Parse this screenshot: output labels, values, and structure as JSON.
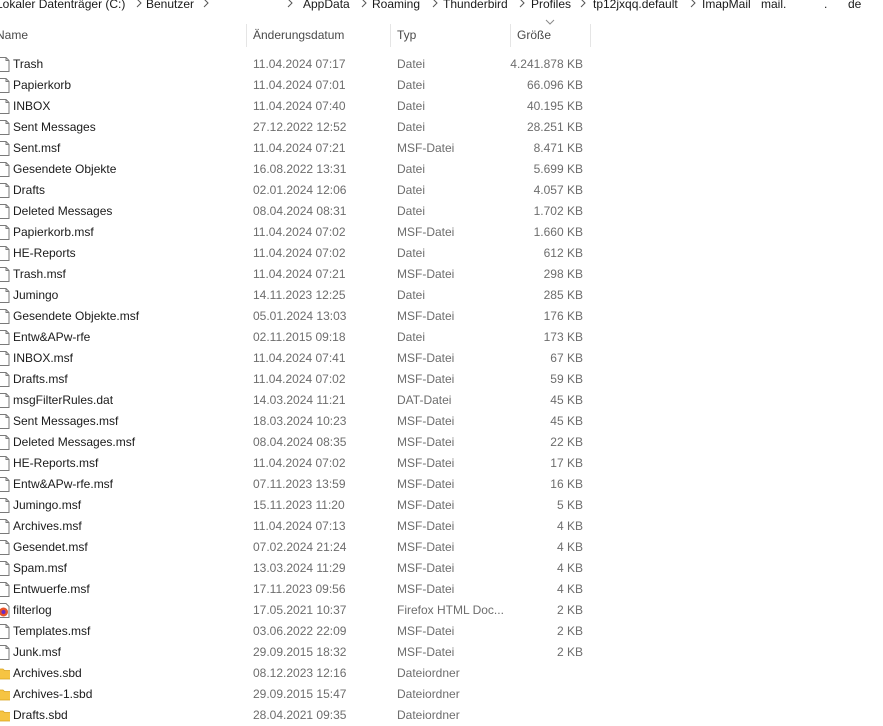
{
  "breadcrumb": {
    "segments": [
      "Lokaler Datenträger (C:)",
      "Benutzer",
      "AppData",
      "Roaming",
      "Thunderbird",
      "Profiles",
      "tp12jxqq.default",
      "ImapMail",
      "mail.",
      ".",
      "de"
    ]
  },
  "columns": {
    "name": "Name",
    "date": "Änderungsdatum",
    "type": "Typ",
    "size": "Größe"
  },
  "icons": {
    "file": "file-icon",
    "folder": "folder-icon",
    "html": "firefox-html-icon",
    "separator": "chevron-right-icon",
    "sort": "sort-descending-icon"
  },
  "colors": {
    "folder": "#f6c443",
    "firefox": "#e8532a"
  },
  "files": [
    {
      "name": "Trash",
      "date": "11.04.2024 07:17",
      "type": "Datei",
      "size": "4.241.878 KB",
      "icon": "file"
    },
    {
      "name": "Papierkorb",
      "date": "11.04.2024 07:01",
      "type": "Datei",
      "size": "66.096 KB",
      "icon": "file"
    },
    {
      "name": "INBOX",
      "date": "11.04.2024 07:40",
      "type": "Datei",
      "size": "40.195 KB",
      "icon": "file"
    },
    {
      "name": "Sent Messages",
      "date": "27.12.2022 12:52",
      "type": "Datei",
      "size": "28.251 KB",
      "icon": "file"
    },
    {
      "name": "Sent.msf",
      "date": "11.04.2024 07:21",
      "type": "MSF-Datei",
      "size": "8.471 KB",
      "icon": "file"
    },
    {
      "name": "Gesendete Objekte",
      "date": "16.08.2022 13:31",
      "type": "Datei",
      "size": "5.699 KB",
      "icon": "file"
    },
    {
      "name": "Drafts",
      "date": "02.01.2024 12:06",
      "type": "Datei",
      "size": "4.057 KB",
      "icon": "file"
    },
    {
      "name": "Deleted Messages",
      "date": "08.04.2024 08:31",
      "type": "Datei",
      "size": "1.702 KB",
      "icon": "file"
    },
    {
      "name": "Papierkorb.msf",
      "date": "11.04.2024 07:02",
      "type": "MSF-Datei",
      "size": "1.660 KB",
      "icon": "file"
    },
    {
      "name": "HE-Reports",
      "date": "11.04.2024 07:02",
      "type": "Datei",
      "size": "612 KB",
      "icon": "file"
    },
    {
      "name": "Trash.msf",
      "date": "11.04.2024 07:21",
      "type": "MSF-Datei",
      "size": "298 KB",
      "icon": "file"
    },
    {
      "name": "Jumingo",
      "date": "14.11.2023 12:25",
      "type": "Datei",
      "size": "285 KB",
      "icon": "file"
    },
    {
      "name": "Gesendete Objekte.msf",
      "date": "05.01.2024 13:03",
      "type": "MSF-Datei",
      "size": "176 KB",
      "icon": "file"
    },
    {
      "name": "Entw&APw-rfe",
      "date": "02.11.2015 09:18",
      "type": "Datei",
      "size": "173 KB",
      "icon": "file"
    },
    {
      "name": "INBOX.msf",
      "date": "11.04.2024 07:41",
      "type": "MSF-Datei",
      "size": "67 KB",
      "icon": "file"
    },
    {
      "name": "Drafts.msf",
      "date": "11.04.2024 07:02",
      "type": "MSF-Datei",
      "size": "59 KB",
      "icon": "file"
    },
    {
      "name": "msgFilterRules.dat",
      "date": "14.03.2024 11:21",
      "type": "DAT-Datei",
      "size": "45 KB",
      "icon": "file"
    },
    {
      "name": "Sent Messages.msf",
      "date": "18.03.2024 10:23",
      "type": "MSF-Datei",
      "size": "45 KB",
      "icon": "file"
    },
    {
      "name": "Deleted Messages.msf",
      "date": "08.04.2024 08:35",
      "type": "MSF-Datei",
      "size": "22 KB",
      "icon": "file"
    },
    {
      "name": "HE-Reports.msf",
      "date": "11.04.2024 07:02",
      "type": "MSF-Datei",
      "size": "17 KB",
      "icon": "file"
    },
    {
      "name": "Entw&APw-rfe.msf",
      "date": "07.11.2023 13:59",
      "type": "MSF-Datei",
      "size": "16 KB",
      "icon": "file"
    },
    {
      "name": "Jumingo.msf",
      "date": "15.11.2023 11:20",
      "type": "MSF-Datei",
      "size": "5 KB",
      "icon": "file"
    },
    {
      "name": "Archives.msf",
      "date": "11.04.2024 07:13",
      "type": "MSF-Datei",
      "size": "4 KB",
      "icon": "file"
    },
    {
      "name": "Gesendet.msf",
      "date": "07.02.2024 21:24",
      "type": "MSF-Datei",
      "size": "4 KB",
      "icon": "file"
    },
    {
      "name": "Spam.msf",
      "date": "13.03.2024 11:29",
      "type": "MSF-Datei",
      "size": "4 KB",
      "icon": "file"
    },
    {
      "name": "Entwuerfe.msf",
      "date": "17.11.2023 09:56",
      "type": "MSF-Datei",
      "size": "4 KB",
      "icon": "file"
    },
    {
      "name": "filterlog",
      "date": "17.05.2021 10:37",
      "type": "Firefox HTML Doc...",
      "size": "2 KB",
      "icon": "html"
    },
    {
      "name": "Templates.msf",
      "date": "03.06.2022 22:09",
      "type": "MSF-Datei",
      "size": "2 KB",
      "icon": "file"
    },
    {
      "name": "Junk.msf",
      "date": "29.09.2015 18:32",
      "type": "MSF-Datei",
      "size": "2 KB",
      "icon": "file"
    },
    {
      "name": "Archives.sbd",
      "date": "08.12.2023 12:16",
      "type": "Dateiordner",
      "size": "",
      "icon": "folder"
    },
    {
      "name": "Archives-1.sbd",
      "date": "29.09.2015 15:47",
      "type": "Dateiordner",
      "size": "",
      "icon": "folder"
    },
    {
      "name": "Drafts.sbd",
      "date": "28.04.2021 09:35",
      "type": "Dateiordner",
      "size": "",
      "icon": "folder"
    }
  ]
}
